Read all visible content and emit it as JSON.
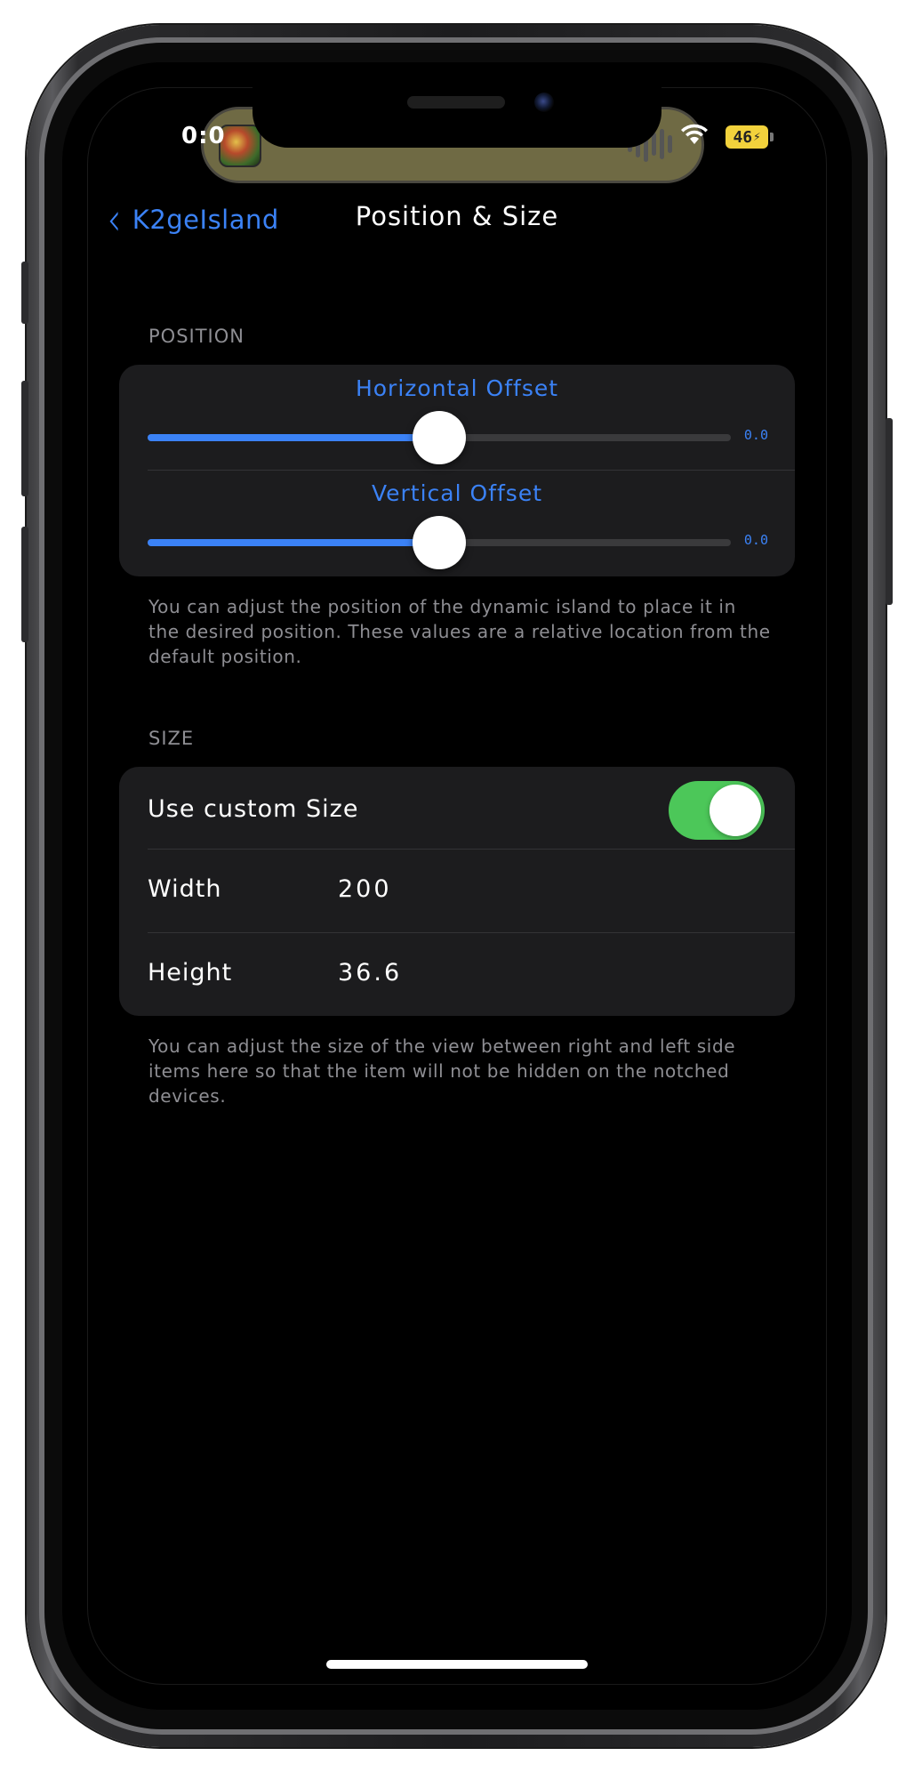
{
  "status": {
    "time": "0:0",
    "battery": "46"
  },
  "nav": {
    "back_label": "K2geIsland",
    "title": "Position & Size"
  },
  "position": {
    "header": "POSITION",
    "horizontal": {
      "title": "Horizontal Offset",
      "value": "0.0",
      "fraction": 0.5
    },
    "vertical": {
      "title": "Vertical Offset",
      "value": "0.0",
      "fraction": 0.5
    },
    "footer": "You can adjust the position of the dynamic island to place it in the desired position. These values are a relative location from the default position."
  },
  "size": {
    "header": "SIZE",
    "custom_label": "Use custom Size",
    "custom_on": true,
    "width_label": "Width",
    "width_value": "200",
    "height_label": "Height",
    "height_value": "36.6",
    "footer": "You can adjust the size of the view between right and left side items here so that the item will not be hidden on the notched devices."
  },
  "colors": {
    "accent": "#3b82f6",
    "toggle_on": "#4cc759",
    "island": "#6f6a44",
    "battery": "#f2d23c"
  }
}
